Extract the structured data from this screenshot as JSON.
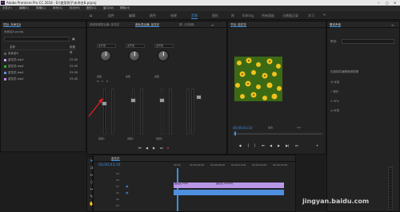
{
  "titlebar": {
    "app_icon": "Pr",
    "title": "Adobe Premiere Pro CC 2018 - D:\\使用例子\\未命名8.prproj",
    "minimize": "─",
    "maximize": "□",
    "close": "✕"
  },
  "menu": [
    "文件(F)",
    "编辑(E)",
    "剪辑(C)",
    "序列(S)",
    "标记(M)",
    "图形(G)",
    "窗口(W)",
    "帮助(H)"
  ],
  "workspaces": [
    "组件",
    "编辑",
    "颜色",
    "效果",
    "音频",
    "图形",
    "库",
    "Editing",
    "所有面板",
    "元数据记录",
    "学习"
  ],
  "project": {
    "tab": "项目: 未命名8",
    "file": "未命名8.prproj",
    "header_name": "名称",
    "header_rate": "帧速率",
    "items": [
      {
        "name": "未命名8",
        "rate": "",
        "color": "#5b5b5b"
      },
      {
        "name": "苗花花.mp4",
        "rate": "25.00",
        "color": "#d1a4f0"
      },
      {
        "name": "苗花花.mp4",
        "rate": "25.00",
        "color": "#2fb12f"
      },
      {
        "name": "苗花花.mp4",
        "rate": "25.00",
        "color": "#5f8fe0"
      },
      {
        "name": "苗花花.mp4",
        "rate": "25.00",
        "color": "#c08ae8"
      }
    ]
  },
  "mixer": {
    "tabs": [
      "音频剪辑混合器: 苗花花",
      "音轨混合器: 苗花花",
      "源: (无剪辑)"
    ],
    "dropdowns": [
      "主声道",
      "主声道",
      "主声道"
    ],
    "read_labels": [
      "读取",
      "读取",
      "读取"
    ],
    "track_labels": [
      "音频1",
      "音频2",
      "音频3"
    ],
    "markers": [
      "M",
      "S",
      "R"
    ],
    "ctl": [
      "⏮",
      "◀",
      "▶",
      "⏭",
      "⏺"
    ]
  },
  "program": {
    "tab": "节目: 苗花花",
    "timecode": "00;00;03;10",
    "fit": "适合",
    "ratio": "1/2",
    "controls": [
      "◆",
      "{",
      "}",
      "⏮",
      "◀",
      "▶",
      "▶|",
      "⏭",
      "+"
    ]
  },
  "effects": {
    "tab": "基本声音",
    "preset_label": "预设:",
    "message": "向选择并编辑音频剪辑",
    "types": [
      "对话",
      "音乐",
      "SFX",
      "环境"
    ]
  },
  "timeline": {
    "tab": "苗花花",
    "timecode": "00;00;03;10",
    "ruler": [
      "00;00",
      "00;00;04;00",
      "00;00;08;00",
      "00;00;12;00",
      "00;00;16;00",
      "00;00;20;00",
      "00;00;24;00"
    ],
    "tracks": [
      "V3",
      "V2",
      "V1",
      "A1",
      "A2",
      "A3"
    ],
    "clips": [
      {
        "label": "苗花花.mp4",
        "color": "#b997e8"
      },
      {
        "label": "苗花花.mp4[V]",
        "color": "#b997e8"
      }
    ]
  },
  "watermark": "jingyan.baidu.com"
}
